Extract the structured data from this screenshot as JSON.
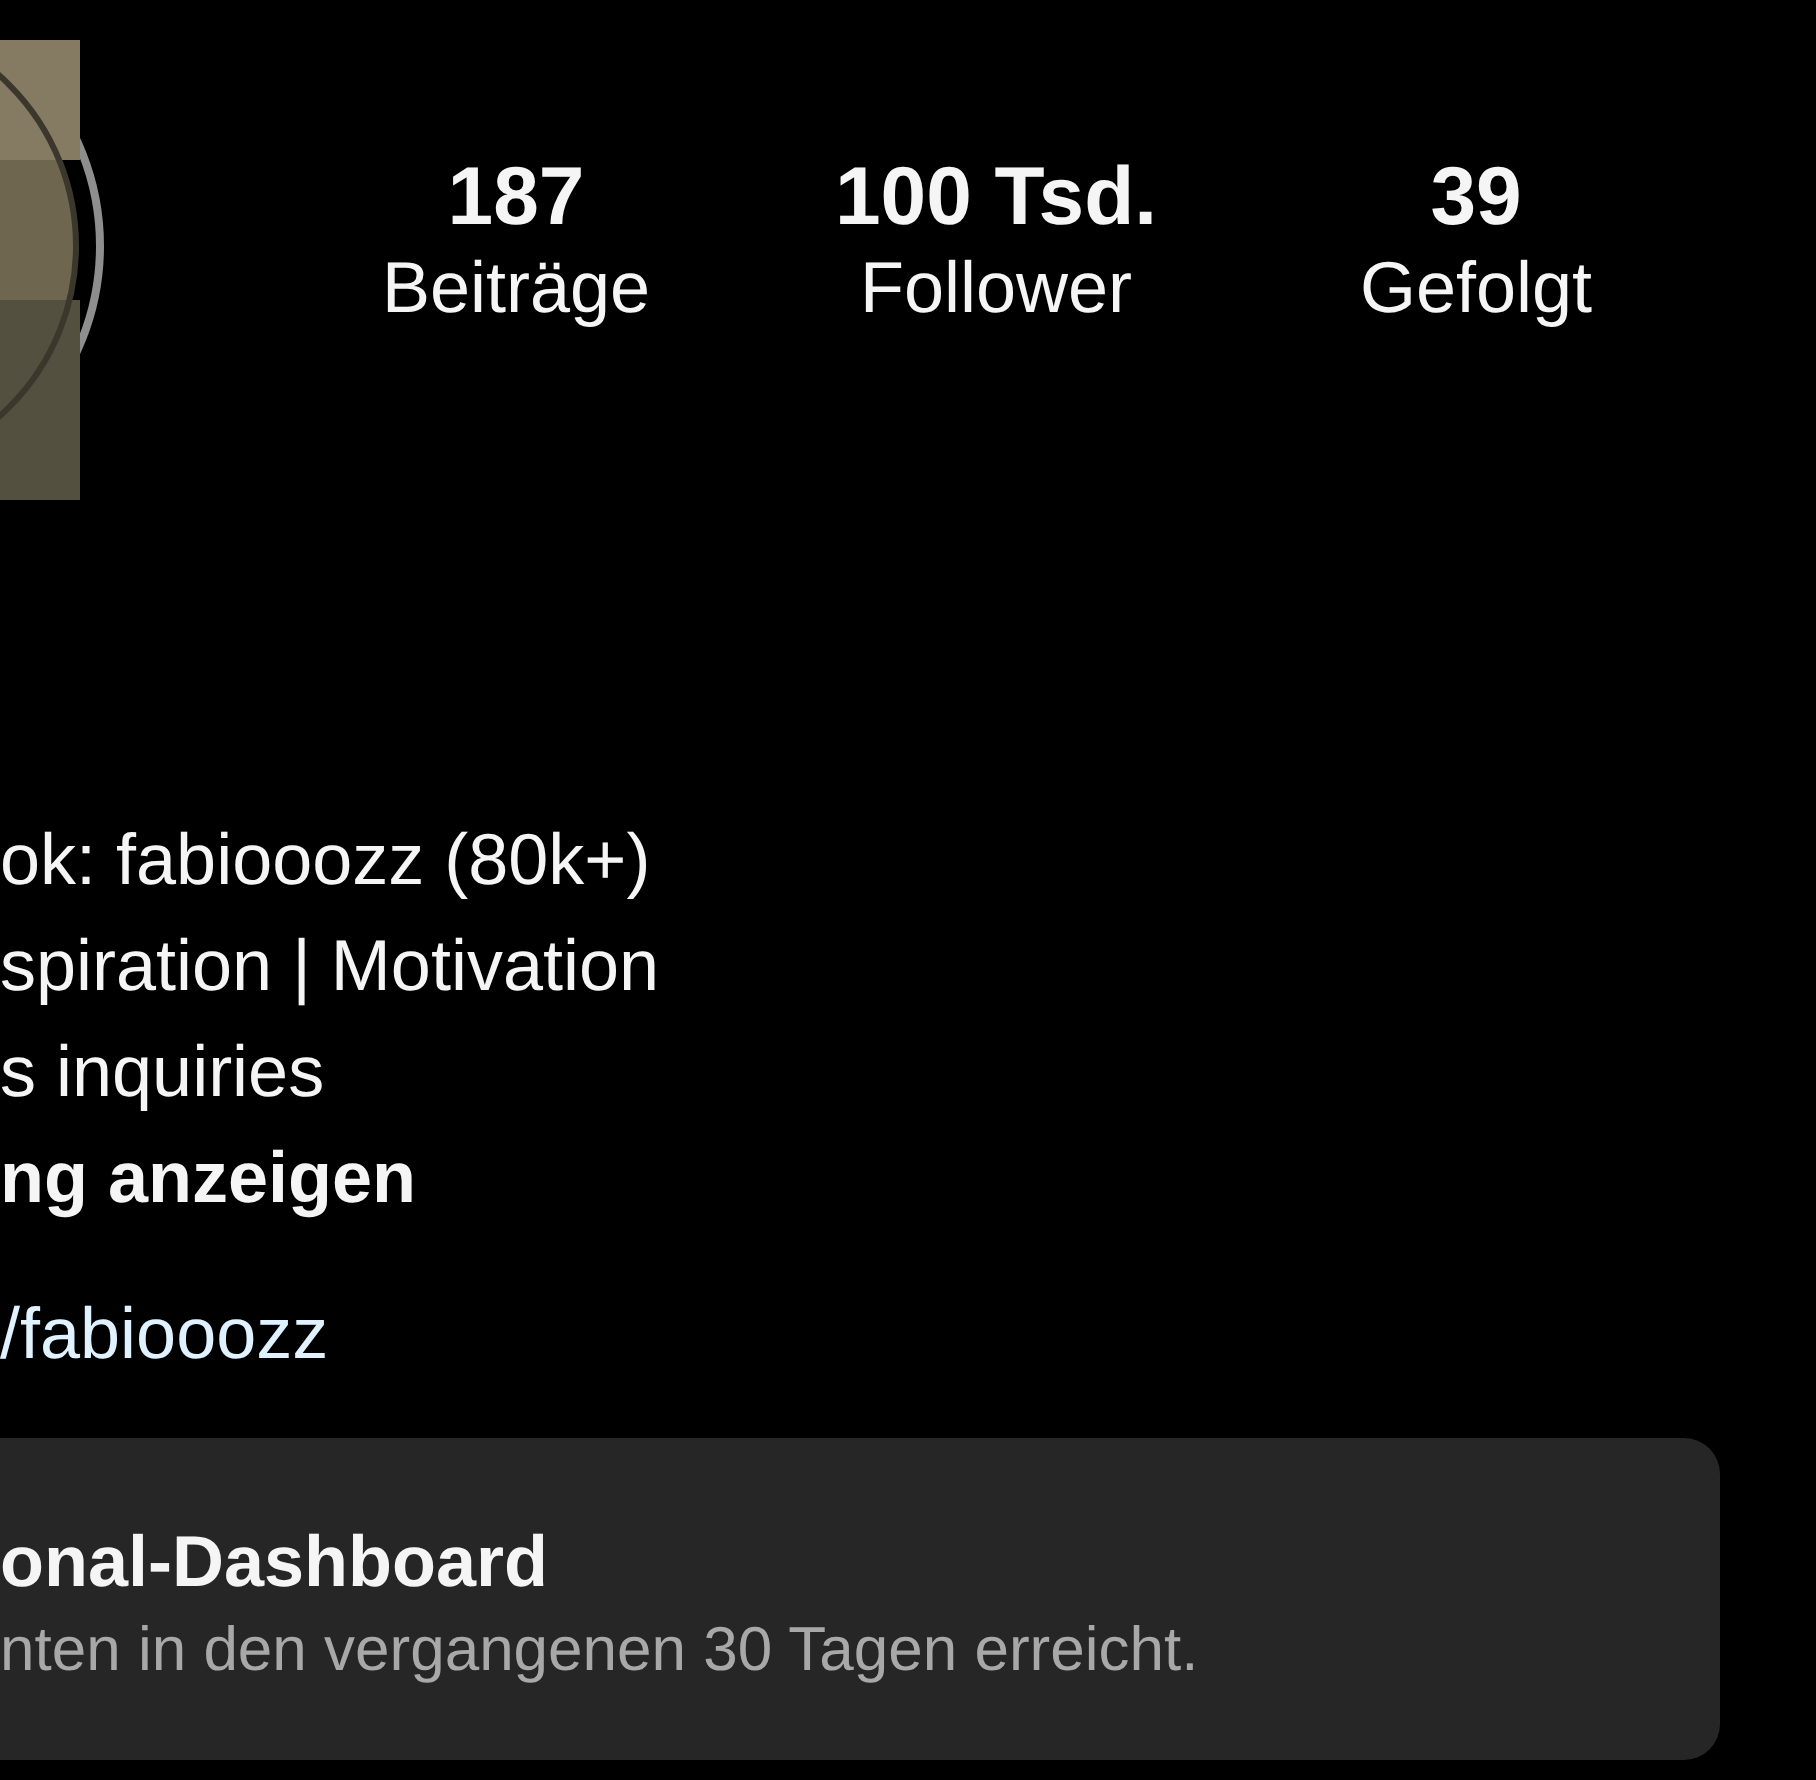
{
  "profile": {
    "stats": [
      {
        "value": "187",
        "label": "Beiträge"
      },
      {
        "value": "100 Tsd.",
        "label": "Follower"
      },
      {
        "value": "39",
        "label": "Gefolgt"
      }
    ],
    "bio": [
      {
        "text": "ok: fabiooozz (80k+)",
        "kind": "plain"
      },
      {
        "text": "spiration | Motivation",
        "kind": "plain"
      },
      {
        "text": "s inquiries",
        "kind": "plain"
      },
      {
        "text": "ng anzeigen",
        "kind": "more"
      }
    ],
    "link": "/fabiooozz"
  },
  "dashboard": {
    "title": "onal-Dashboard",
    "subtitle": "nten in den vergangenen 30 Tagen erreicht."
  }
}
